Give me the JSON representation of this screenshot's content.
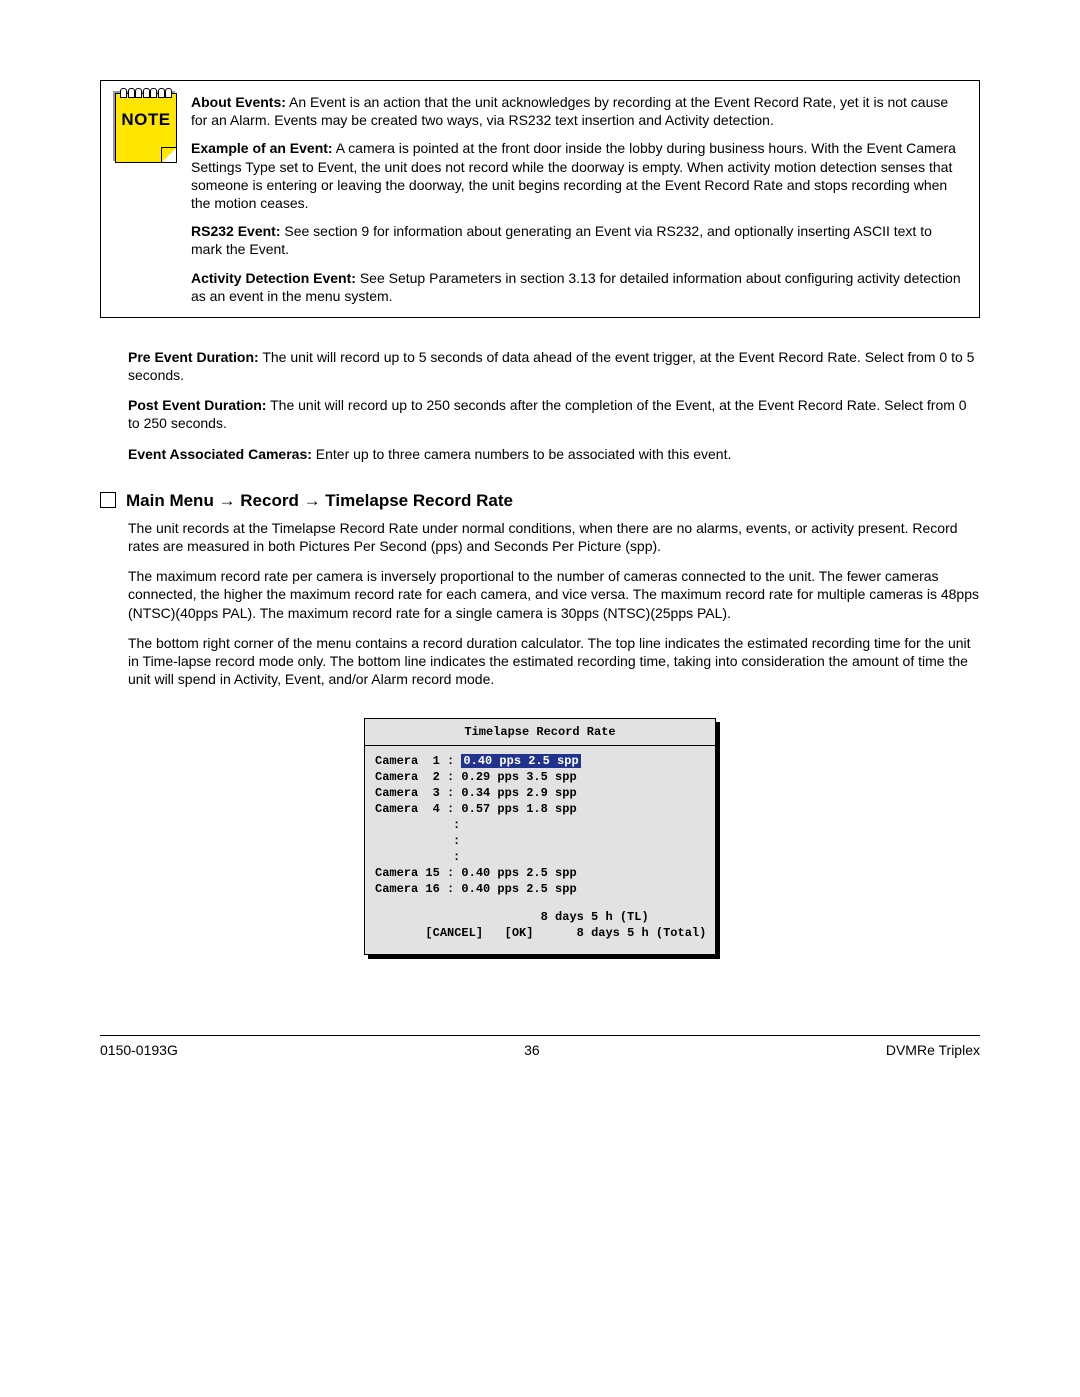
{
  "note": {
    "icon_label": "NOTE",
    "paras": [
      {
        "b": "About Events:",
        "t": "  An Event is an action that the unit acknowledges by recording at the Event Record Rate, yet it is not cause for an Alarm.  Events may be created two ways, via RS232 text insertion and Activity detection."
      },
      {
        "b": "Example of an Event:",
        "t": "  A camera is pointed at the front door inside the lobby during business hours.  With the Event Camera Settings Type set to Event, the unit does not record while the doorway is empty.  When activity motion detection senses that someone is entering or leaving the doorway, the unit begins recording at the Event Record Rate and stops recording when the motion ceases."
      },
      {
        "b": "RS232 Event:",
        "t": "  See section 9 for information about generating an Event via RS232, and optionally inserting ASCII text to mark the Event."
      },
      {
        "b": "Activity Detection Event:",
        "t": " See Setup Parameters in section 3.13 for detailed information about configuring activity detection as an event in the menu system."
      }
    ]
  },
  "paras": [
    {
      "b": "Pre Event Duration:",
      "t": "  The unit will record up to 5 seconds of data ahead of the event trigger, at the Event Record Rate.  Select from 0 to 5 seconds."
    },
    {
      "b": "Post Event Duration:",
      "t": "  The unit will record up to 250 seconds after the completion of the Event, at the Event Record Rate.  Select from 0 to 250 seconds."
    },
    {
      "b": "Event Associated Cameras:",
      "t": "  Enter up to three camera numbers to be associated with this event."
    }
  ],
  "heading": "Main Menu → Record → Timelapse Record Rate",
  "body_paras": [
    "The unit records at the Timelapse Record Rate under normal conditions, when there are no alarms, events, or activity present.  Record rates are measured in both Pictures Per Second (pps) and Seconds Per Picture (spp).",
    "The maximum record rate per camera is inversely proportional to the number of cameras connected to the unit. The fewer cameras connected, the higher the maximum record rate for each camera, and vice versa.  The maximum record rate for multiple cameras is 48pps (NTSC)(40pps PAL).  The maximum record rate for a single camera is 30pps (NTSC)(25pps PAL).",
    "The bottom right corner of the menu contains a record duration calculator.  The top line indicates the estimated recording time for the unit in Time-lapse record mode only.  The bottom line indicates the estimated recording time, taking into consideration the amount of time the unit will spend in Activity, Event, and/or Alarm record mode."
  ],
  "menu": {
    "title": "Timelapse Record Rate",
    "rows": [
      {
        "label": "Camera  1 : ",
        "sel": true,
        "val": "0.40 pps 2.5 spp"
      },
      {
        "label": "Camera  2 : ",
        "sel": false,
        "val": "0.29 pps 3.5 spp"
      },
      {
        "label": "Camera  3 : ",
        "sel": false,
        "val": "0.34 pps 2.9 spp"
      },
      {
        "label": "Camera  4 : ",
        "sel": false,
        "val": "0.57 pps 1.8 spp"
      }
    ],
    "dots": [
      ":",
      ":",
      ":"
    ],
    "rows2": [
      {
        "label": "Camera 15 : ",
        "val": "0.40 pps 2.5 spp"
      },
      {
        "label": "Camera 16 : ",
        "val": "0.40 pps 2.5 spp"
      }
    ],
    "calc_tl": "8 days 5 h (TL)",
    "cancel": "[CANCEL]",
    "ok": "[OK]",
    "calc_total": "8 days 5 h (Total)"
  },
  "footer": {
    "left": "0150-0193G",
    "center": "36",
    "right": "DVMRe Triplex"
  }
}
